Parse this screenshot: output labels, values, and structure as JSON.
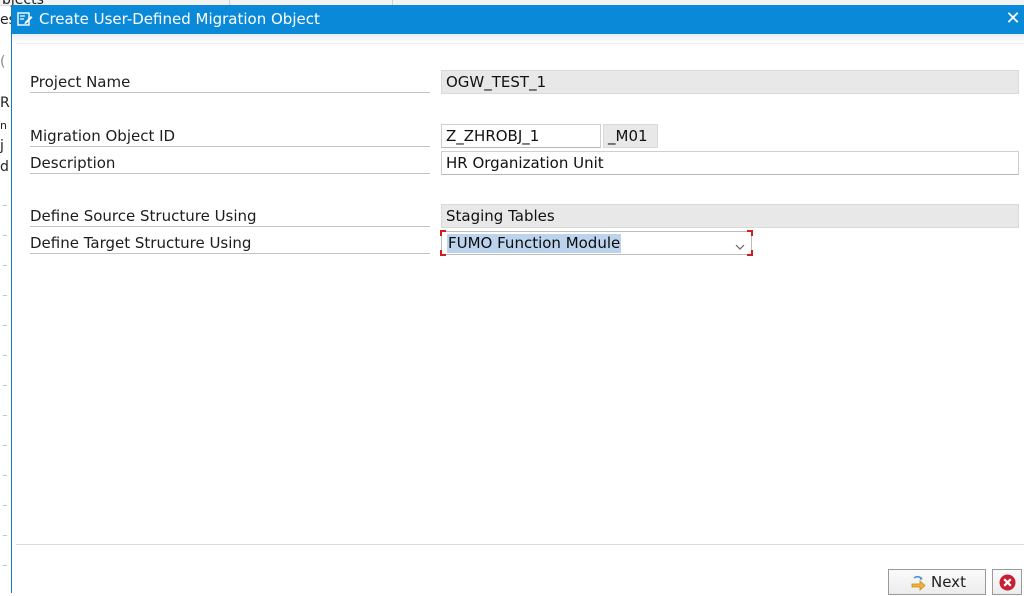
{
  "background_fragments": {
    "top": "bjects",
    "left": [
      "es",
      "(",
      "R",
      "n",
      "j",
      "d"
    ]
  },
  "dialog": {
    "title": "Create User-Defined Migration Object",
    "close_glyph": "✕"
  },
  "form": {
    "project_name": {
      "label": "Project Name",
      "value": "OGW_TEST_1"
    },
    "migration_object_id": {
      "label": "Migration Object ID",
      "value": "Z_ZHROBJ_1",
      "suffix": "_M01"
    },
    "description": {
      "label": "Description",
      "value": "HR Organization Unit"
    },
    "source_structure": {
      "label": "Define Source Structure Using",
      "value": "Staging Tables"
    },
    "target_structure": {
      "label": "Define Target Structure Using",
      "value": "FUMO Function Module"
    }
  },
  "footer": {
    "next_label": "Next"
  },
  "colors": {
    "titlebar": "#0a89d8",
    "readonly_field": "#e8e8e8",
    "selection_highlight": "#bcd3ee",
    "focus_corners": "#d01e1e",
    "cancel_icon": "#c81e32"
  },
  "icons": {
    "title": "dialog-edit-icon",
    "close": "close-icon",
    "dropdown": "chevron-down-icon",
    "next": "next-arrow-icon",
    "cancel": "cancel-icon"
  }
}
